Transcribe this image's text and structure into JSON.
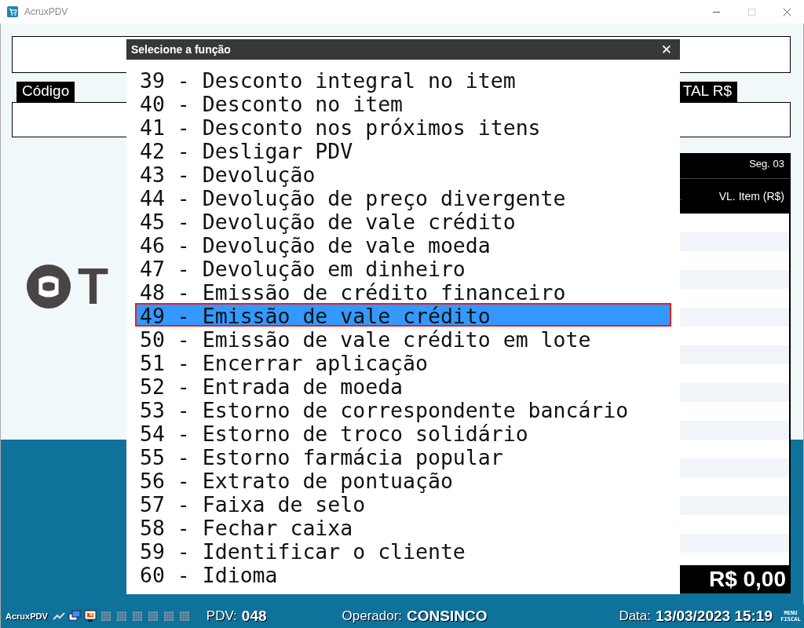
{
  "window": {
    "title": "AcruxPDV"
  },
  "labels": {
    "code": "Código",
    "total": "TAL R$"
  },
  "logo": {
    "text": "T"
  },
  "items_panel": {
    "segment": "Seg. 03",
    "column_1": ".",
    "column_2": "VL. Item (R$)",
    "total": "R$ 0,00"
  },
  "dialog": {
    "title": "Selecione a função",
    "close": "✕",
    "options": [
      {
        "label": "39 - Desconto integral no item",
        "selected": false
      },
      {
        "label": "40 - Desconto no item",
        "selected": false
      },
      {
        "label": "41 - Desconto nos próximos itens",
        "selected": false
      },
      {
        "label": "42 - Desligar PDV",
        "selected": false
      },
      {
        "label": "43 - Devolução",
        "selected": false
      },
      {
        "label": "44 - Devolução de preço divergente",
        "selected": false
      },
      {
        "label": "45 - Devolução de vale crédito",
        "selected": false
      },
      {
        "label": "46 - Devolução de vale moeda",
        "selected": false
      },
      {
        "label": "47 - Devolução em dinheiro",
        "selected": false
      },
      {
        "label": "48 - Emissão de crédito financeiro",
        "selected": false
      },
      {
        "label": "49 - Emissão de vale crédito",
        "selected": true
      },
      {
        "label": "50 - Emissão de vale crédito em lote",
        "selected": false
      },
      {
        "label": "51 - Encerrar aplicação",
        "selected": false
      },
      {
        "label": "52 - Entrada de moeda",
        "selected": false
      },
      {
        "label": "53 - Estorno de correspondente bancário",
        "selected": false
      },
      {
        "label": "54 - Estorno de troco solidário",
        "selected": false
      },
      {
        "label": "55 - Estorno farmácia popular",
        "selected": false
      },
      {
        "label": "56 - Extrato de pontuação",
        "selected": false
      },
      {
        "label": "57 - Faixa de selo",
        "selected": false
      },
      {
        "label": "58 - Fechar caixa",
        "selected": false
      },
      {
        "label": "59 - Identificar o cliente",
        "selected": false
      },
      {
        "label": "60 - Idioma",
        "selected": false
      }
    ]
  },
  "status_bar": {
    "app": "AcruxPDV",
    "pdv_label": "PDV:",
    "pdv": "048",
    "operator_label": "Operador:",
    "operator": "CONSINCO",
    "date_label": "Data:",
    "date": "13/03/2023 15:19",
    "menu_fiscal": "MENU FISCAL"
  }
}
